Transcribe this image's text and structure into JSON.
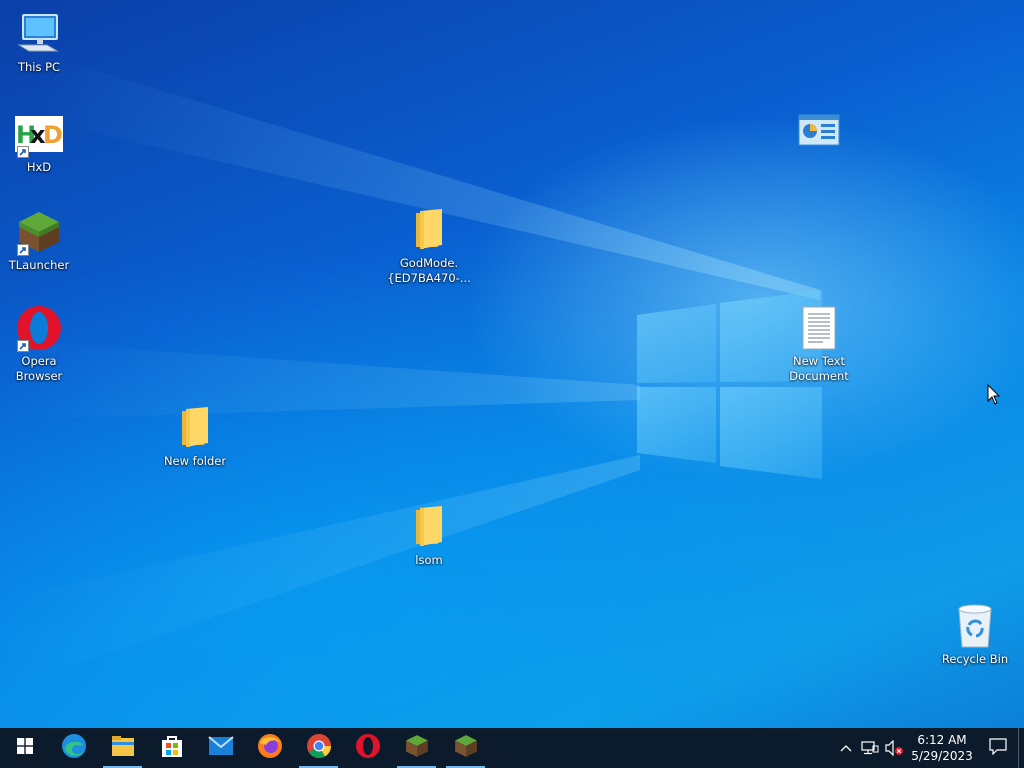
{
  "desktop": {
    "icons": [
      {
        "label": "This PC",
        "icon": "computer-icon",
        "shortcut": false
      },
      {
        "label": "HxD",
        "icon": "hxd-icon",
        "shortcut": true
      },
      {
        "label": "TLauncher",
        "icon": "minecraft-grass-block-icon",
        "shortcut": true
      },
      {
        "label": "Opera\nBrowser",
        "icon": "opera-icon",
        "shortcut": true
      },
      {
        "label": "New folder",
        "icon": "folder-icon",
        "shortcut": false
      },
      {
        "label": "GodMode.\n{ED7BA470-...",
        "icon": "folder-icon",
        "shortcut": false
      },
      {
        "label": "lsom",
        "icon": "folder-icon",
        "shortcut": false
      },
      {
        "label": "",
        "icon": "control-panel-icon",
        "shortcut": false
      },
      {
        "label": "New Text\nDocument",
        "icon": "text-document-icon",
        "shortcut": false
      },
      {
        "label": "Recycle Bin",
        "icon": "recycle-bin-icon",
        "shortcut": false
      }
    ]
  },
  "taskbar": {
    "apps": [
      {
        "name": "start",
        "icon": "windows-logo-icon",
        "running": false
      },
      {
        "name": "edge",
        "icon": "edge-icon",
        "running": false
      },
      {
        "name": "file-explorer",
        "icon": "file-explorer-icon",
        "running": true
      },
      {
        "name": "store",
        "icon": "microsoft-store-icon",
        "running": false
      },
      {
        "name": "mail",
        "icon": "mail-icon",
        "running": false
      },
      {
        "name": "firefox",
        "icon": "firefox-icon",
        "running": false
      },
      {
        "name": "chrome",
        "icon": "chrome-icon",
        "running": true
      },
      {
        "name": "opera",
        "icon": "opera-icon",
        "running": false
      },
      {
        "name": "minecraft-1",
        "icon": "minecraft-grass-block-icon",
        "running": true
      },
      {
        "name": "minecraft-2",
        "icon": "minecraft-grass-block-icon",
        "running": true
      }
    ],
    "tray": {
      "chevron_icon": "chevron-up-icon",
      "network_icon": "network-icon",
      "volume_icon": "volume-muted-icon",
      "time": "6:12 AM",
      "date": "5/29/2023",
      "notification_icon": "action-center-icon"
    }
  },
  "colors": {
    "taskbar": "#0c1b2b",
    "running_indicator": "#76b9ed",
    "desktop_accent": "#0a6fd6"
  }
}
